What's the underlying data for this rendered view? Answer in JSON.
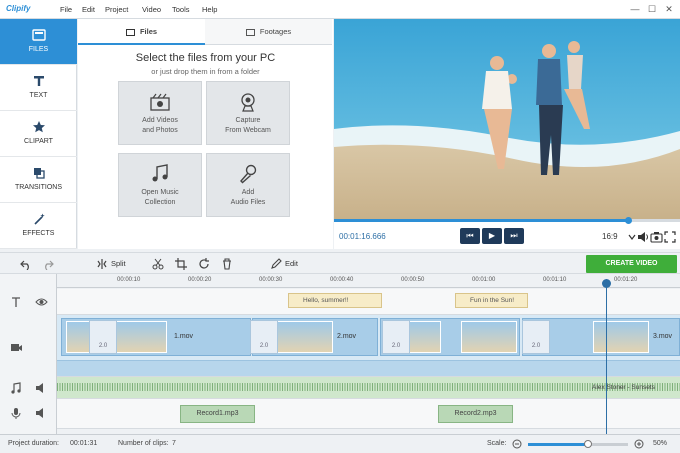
{
  "app": {
    "logo": "Clipify"
  },
  "menu": [
    "File",
    "Edit",
    "Project",
    "Video",
    "Tools",
    "Help"
  ],
  "window_controls": {
    "minimize": "—",
    "maximize": "☐",
    "close": "✕"
  },
  "sidebar": {
    "items": [
      {
        "label": "FILES",
        "icon": "files-icon",
        "active": true
      },
      {
        "label": "TEXT",
        "icon": "text-icon",
        "active": false
      },
      {
        "label": "CLIPART",
        "icon": "star-icon",
        "active": false
      },
      {
        "label": "TRANSITIONS",
        "icon": "transitions-icon",
        "active": false
      },
      {
        "label": "EFFECTS",
        "icon": "wand-icon",
        "active": false
      }
    ]
  },
  "files_panel": {
    "tabs": [
      {
        "label": "Files",
        "active": true
      },
      {
        "label": "Footages",
        "active": false
      }
    ],
    "heading": "Select the files from your PC",
    "subheading": "or just drop them in from a folder",
    "cards": [
      {
        "line1": "Add Videos",
        "line2": "and Photos",
        "icon": "film-icon"
      },
      {
        "line1": "Capture",
        "line2": "From Webcam",
        "icon": "webcam-icon"
      },
      {
        "line1": "Open Music",
        "line2": "Collection",
        "icon": "music-icon"
      },
      {
        "line1": "Add",
        "line2": "Audio Files",
        "icon": "microphone-icon"
      }
    ]
  },
  "preview": {
    "timecode": "00:01:16.666",
    "aspect": "16:9",
    "progress": 0.85,
    "controls": {
      "prev": "⏮",
      "play": "▶",
      "next": "⏭"
    }
  },
  "toolbar": {
    "split": "Split",
    "edit": "Edit",
    "create_video": "CREATE VIDEO"
  },
  "timeline": {
    "ticks": [
      "00:00:10",
      "00:00:20",
      "00:00:30",
      "00:00:40",
      "00:00:50",
      "00:01:00",
      "00:01:10",
      "00:01:20"
    ],
    "captions": [
      "Hello, summer!!",
      "Fun in the Sun!"
    ],
    "clips": [
      "1.mov",
      "2.mov",
      "3.mov"
    ],
    "transition_duration": "2.0",
    "audio_track": "Alex Stoner - Sunsets",
    "records": [
      "Record1.mp3",
      "Record2.mp3"
    ]
  },
  "status": {
    "project_duration_label": "Project duration:",
    "project_duration": "00:01:31",
    "clips_label": "Number of clips:",
    "clips_count": "7",
    "scale_label": "Scale:",
    "scale_value": "50%",
    "scale_level": 0.6
  },
  "colors": {
    "accent": "#2d8fd6",
    "create": "#3fae3a",
    "dark_button": "#1f3a5a"
  }
}
